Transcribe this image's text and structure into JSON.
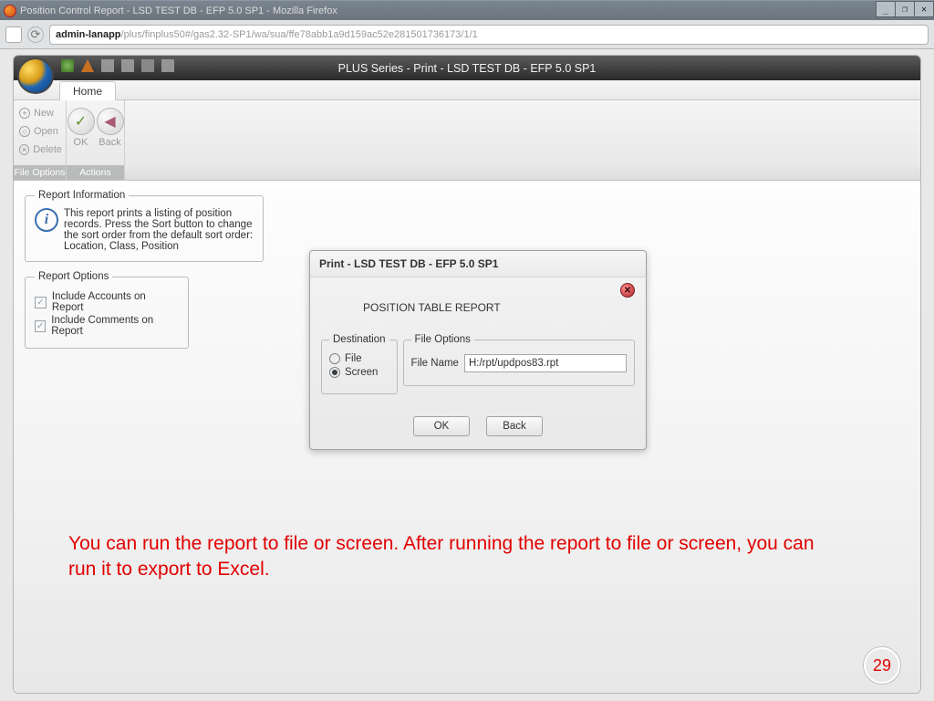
{
  "browser": {
    "window_title": "Position Control Report - LSD TEST DB - EFP 5.0 SP1 - Mozilla Firefox",
    "url_host": "admin-lanapp",
    "url_path": "/plus/finplus50#/gas2.32-SP1/wa/sua/ffe78abb1a9d159ac52e281501736173/1/1"
  },
  "app": {
    "title": "PLUS Series - Print - LSD TEST DB - EFP 5.0 SP1",
    "tab": "Home",
    "file_options": {
      "group_label": "File Options",
      "new": "New",
      "open": "Open",
      "delete": "Delete"
    },
    "actions": {
      "group_label": "Actions",
      "ok": "OK",
      "back": "Back"
    }
  },
  "report_info": {
    "legend": "Report Information",
    "text": "This report prints a listing of position records. Press the Sort button to change the sort order from the default sort order: Location, Class, Position"
  },
  "report_options": {
    "legend": "Report Options",
    "include_accounts": "Include Accounts on Report",
    "include_comments": "Include Comments on Report"
  },
  "dialog": {
    "title": "Print - LSD TEST DB - EFP 5.0 SP1",
    "heading": "POSITION TABLE REPORT",
    "destination": {
      "legend": "Destination",
      "file": "File",
      "screen": "Screen",
      "selected": "screen"
    },
    "file_options": {
      "legend": "File Options",
      "file_name_label": "File Name",
      "file_name_value": "H:/rpt/updpos83.rpt"
    },
    "ok": "OK",
    "back": "Back"
  },
  "annotation": "You can run the report to file or screen. After running the report to file or screen, you can run it to export to Excel.",
  "page_number": "29"
}
